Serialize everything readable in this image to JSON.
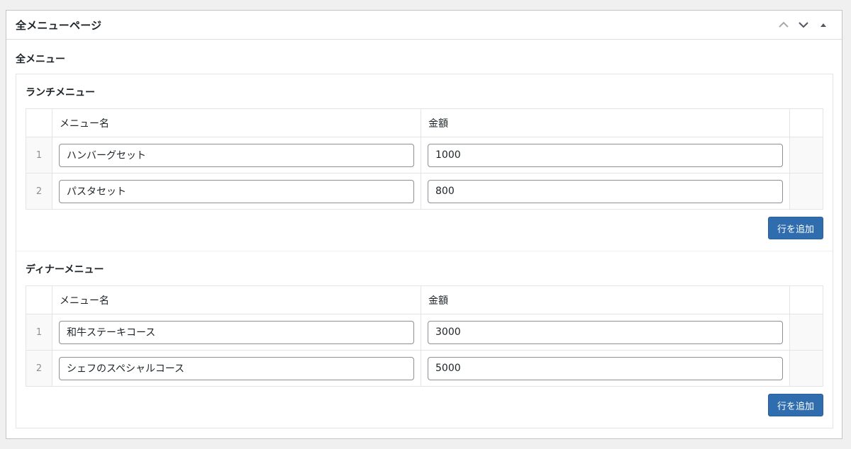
{
  "postbox": {
    "title": "全メニューページ",
    "icons": {
      "move_up": "chevron-up-icon",
      "move_down": "chevron-down-icon",
      "toggle": "triangle-up-icon"
    }
  },
  "field": {
    "label": "全メニュー"
  },
  "groups": [
    {
      "label": "ランチメニュー",
      "columns": [
        "メニュー名",
        "金額"
      ],
      "rows": [
        {
          "index": "1",
          "name": "ハンバーグセット",
          "price": "1000"
        },
        {
          "index": "2",
          "name": "パスタセット",
          "price": "800"
        }
      ],
      "add_button": "行を追加"
    },
    {
      "label": "ディナーメニュー",
      "columns": [
        "メニュー名",
        "金額"
      ],
      "rows": [
        {
          "index": "1",
          "name": "和牛ステーキコース",
          "price": "3000"
        },
        {
          "index": "2",
          "name": "シェフのスペシャルコース",
          "price": "5000"
        }
      ],
      "add_button": "行を追加"
    }
  ],
  "colors": {
    "button": "#2f6dae",
    "background": "#f0f0f1",
    "border": "#c3c4c7"
  }
}
